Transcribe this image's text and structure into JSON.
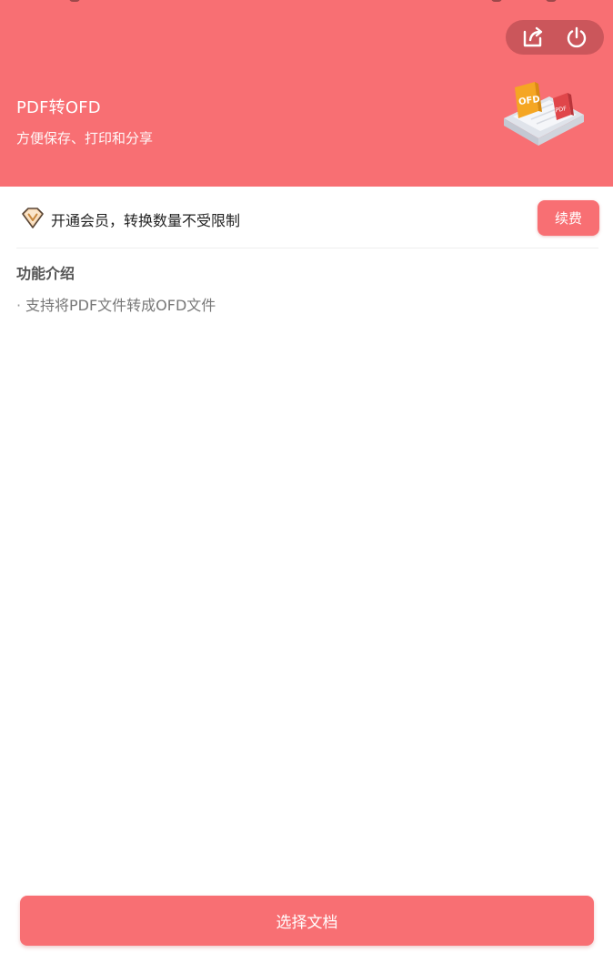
{
  "colors": {
    "brand": "#f86f73",
    "text_primary": "#222222",
    "text_secondary": "#777777",
    "capsule": "#b04a4f"
  },
  "header": {
    "title": "PDF转OFD",
    "subtitle": "方便保存、打印和分享",
    "actions": {
      "share_icon": "share-icon",
      "power_icon": "power-icon"
    },
    "illustration": {
      "badge_ofd": "OFD",
      "badge_pdf": "PDF"
    }
  },
  "membership": {
    "icon": "vip-diamond-icon",
    "text": "开通会员，转换数量不受限制",
    "button_label": "续费"
  },
  "features": {
    "title": "功能介绍",
    "bullet": "·",
    "items": [
      "支持将PDF文件转成OFD文件"
    ]
  },
  "footer": {
    "select_button_label": "选择文档"
  }
}
